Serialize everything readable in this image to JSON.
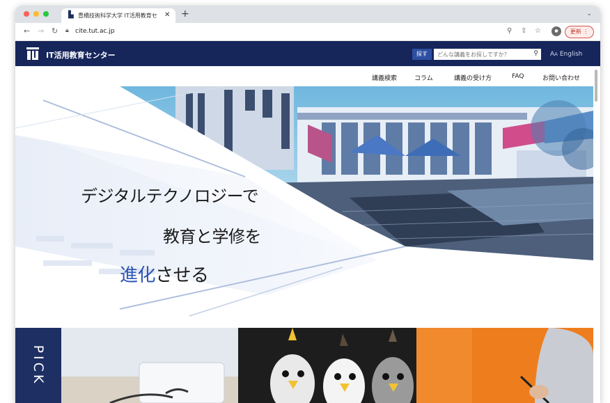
{
  "browser": {
    "tab_title": "豊橋技術科学大学 IT活用教育セ",
    "url": "cite.tut.ac.jp",
    "update_label": "更新"
  },
  "site": {
    "logo_text": "IT活用教育センター",
    "search_button": "探す",
    "search_placeholder": "どんな講義をお探しですか？",
    "lang_label": "English",
    "menu": [
      "講義検索",
      "コラム",
      "講義の受け方",
      "FAQ",
      "お問い合わせ"
    ]
  },
  "hero": {
    "line1": "デジタルテクノロジーで",
    "line2": "教育と学修を",
    "line3_accent": "進化",
    "line3_rest": "させる"
  },
  "pick": {
    "label": "PICK"
  },
  "colors": {
    "navy": "#16255a",
    "accent_blue": "#2e56b5",
    "orange": "#ec7a1c"
  }
}
